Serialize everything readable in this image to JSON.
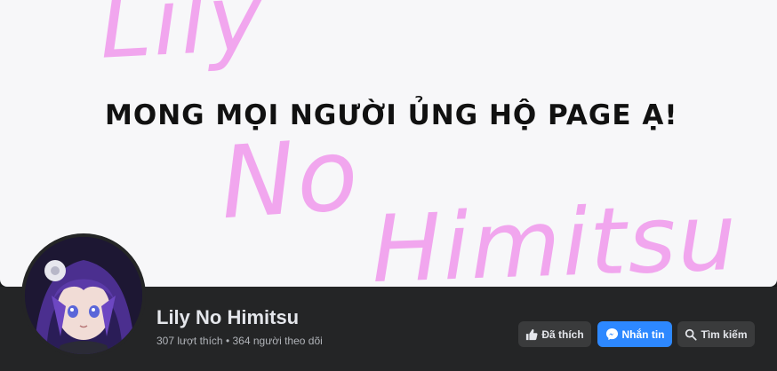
{
  "cover": {
    "script_lines": [
      "Lily",
      "No",
      "Himitsu"
    ],
    "headline": "MONG MỌI NGƯỜI ỦNG HỘ PAGE Ạ!",
    "script_color": "#f1a6ee"
  },
  "page": {
    "name": "Lily No Himitsu",
    "likes": "307 lượt thích",
    "separator": " • ",
    "followers": "364 người theo dõi"
  },
  "actions": {
    "liked_label": "Đã thích",
    "message_label": "Nhắn tin",
    "search_label": "Tìm kiếm"
  },
  "icons": {
    "liked": "thumbs-up-icon",
    "message": "messenger-icon",
    "search": "search-icon"
  },
  "colors": {
    "background": "#18191a",
    "bar": "#242526",
    "primary_button": "#2d88ff",
    "secondary_button": "#3a3b3c"
  }
}
